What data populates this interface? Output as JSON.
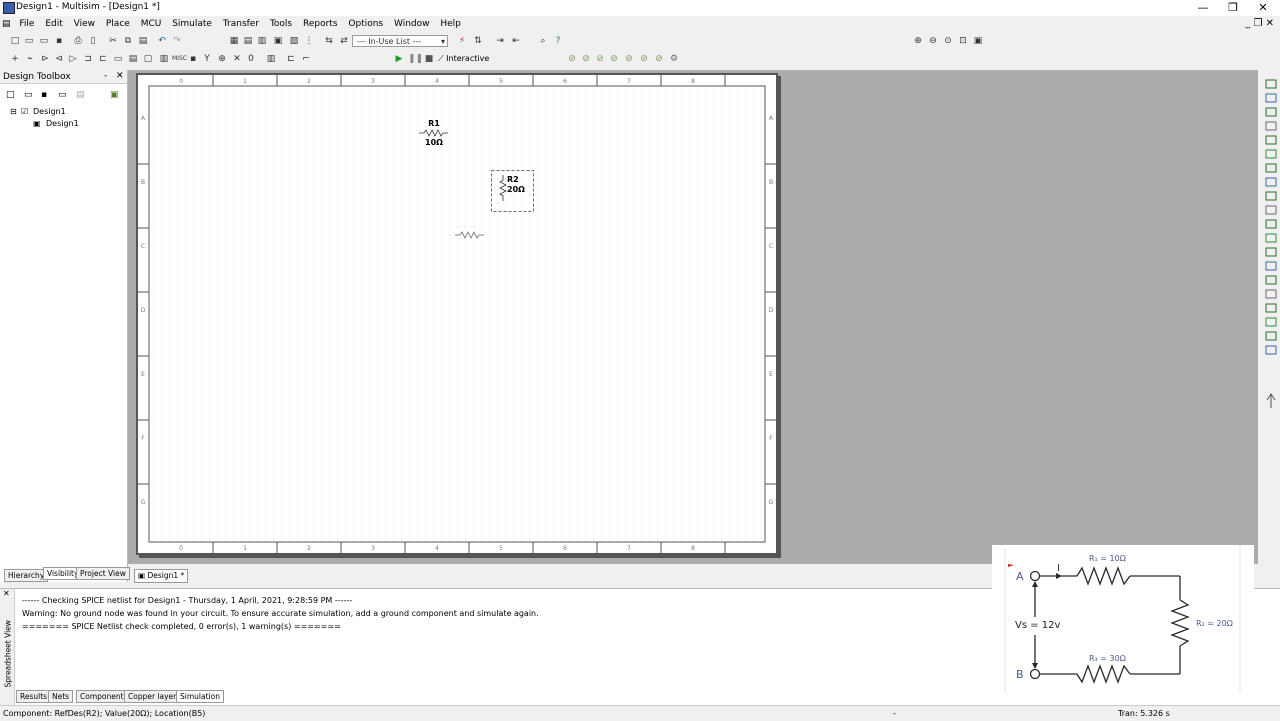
{
  "window": {
    "title": "Design1 - Multisim - [Design1 *]",
    "minimize": "—",
    "restore": "❐",
    "close": "✕"
  },
  "menu": [
    "File",
    "Edit",
    "View",
    "Place",
    "MCU",
    "Simulate",
    "Transfer",
    "Tools",
    "Reports",
    "Options",
    "Window",
    "Help"
  ],
  "toolbar": {
    "in_use_list": "--- In-Use List ---",
    "interactive": "Interactive"
  },
  "toolbox": {
    "title": "Design Toolbox",
    "tree_root": "Design1",
    "tree_child": "Design1",
    "tabs": [
      "Hierarchy",
      "Visibility",
      "Project View"
    ]
  },
  "sheet": {
    "col_labels": [
      "0",
      "1",
      "2",
      "3",
      "4",
      "5",
      "6",
      "7",
      "8"
    ],
    "row_labels": [
      "A",
      "B",
      "C",
      "D",
      "E",
      "F",
      "G"
    ],
    "r1_name": "R1",
    "r1_value": "10Ω",
    "r2_name": "R2",
    "r2_value": "20Ω",
    "doc_tab": "Design1 *"
  },
  "spreadsheet": {
    "side_label": "Spreadsheet View",
    "lines": [
      "------ Checking SPICE netlist for Design1 - Thursday, 1 April, 2021, 9:28:59 PM ------",
      "Warning: No ground node was found in your circuit. To ensure accurate simulation, add a ground component and simulate again.",
      "======= SPICE Netlist check completed, 0 error(s), 1 warning(s) ======="
    ],
    "tabs": [
      "Results",
      "Nets",
      "Components",
      "Copper layers",
      "Simulation"
    ]
  },
  "status": {
    "left": "Component: RefDes(R2); Value(20Ω); Location(B5)",
    "mid": "-",
    "right": "Tran: 5.326 s"
  },
  "overlay": {
    "node_a": "A",
    "node_b": "B",
    "r1": "R₁ = 10Ω",
    "r2": "R₂ = 20Ω",
    "r3": "R₃ = 30Ω",
    "vs": "Vs = 12v"
  },
  "colors": {
    "accent": "#3b5ea8",
    "diagram_line": "#2a2a2a",
    "diagram_text": "#4a5a8a",
    "warn_red": "#cc2222"
  }
}
